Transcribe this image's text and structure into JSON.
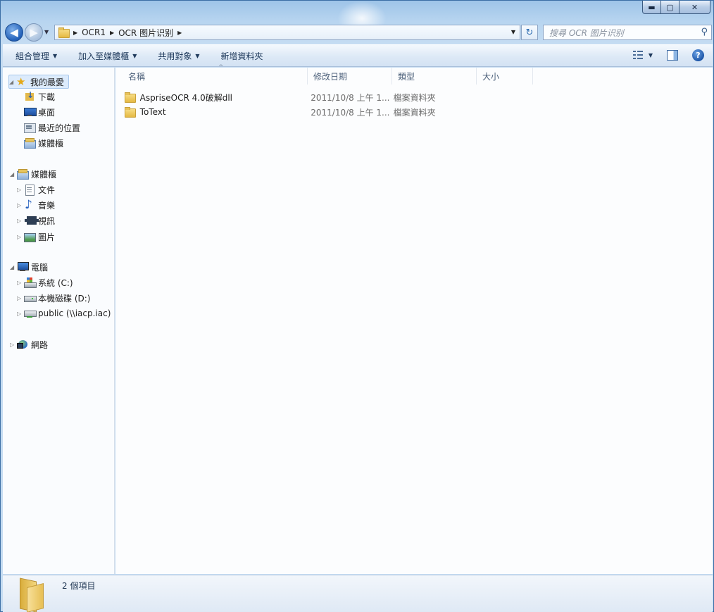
{
  "window": {
    "caption_buttons": {
      "minimize": "▬",
      "maximize": "▢",
      "close": "✕"
    }
  },
  "navbar": {
    "back_glyph": "◀",
    "forward_glyph": "▶",
    "breadcrumbs": [
      "OCR1",
      "OCR 图片识别"
    ],
    "refresh_glyph": "↻",
    "search_placeholder": "搜尋 OCR 图片识别",
    "search_icon": "search-icon"
  },
  "commandbar": {
    "organize": "組合管理",
    "include_in_library": "加入至媒體櫃",
    "share_with": "共用對象",
    "new_folder": "新增資料夾",
    "help": "?"
  },
  "sidebar": {
    "favorites": {
      "label": "我的最愛",
      "items": [
        "下載",
        "桌面",
        "最近的位置",
        "媒體櫃"
      ]
    },
    "libraries": {
      "label": "媒體櫃",
      "items": [
        "文件",
        "音樂",
        "視訊",
        "圖片"
      ]
    },
    "computer": {
      "label": "電腦",
      "items": [
        "系統 (C:)",
        "本機磁碟 (D:)",
        "public (\\\\iacp.iac) ("
      ]
    },
    "network": {
      "label": "網路"
    }
  },
  "columns": {
    "name": "名稱",
    "date": "修改日期",
    "type": "類型",
    "size": "大小"
  },
  "files": [
    {
      "name": "AspriseOCR 4.0破解dll",
      "date": "2011/10/8 上午 1...",
      "type": "檔案資料夾",
      "size": ""
    },
    {
      "name": "ToText",
      "date": "2011/10/8 上午 1...",
      "type": "檔案資料夾",
      "size": ""
    }
  ],
  "details": {
    "count": "2 個項目"
  },
  "colors": {
    "accent": "#3b6ea5",
    "title_bar": "#9ec4e8",
    "command_text": "#1e395b"
  }
}
